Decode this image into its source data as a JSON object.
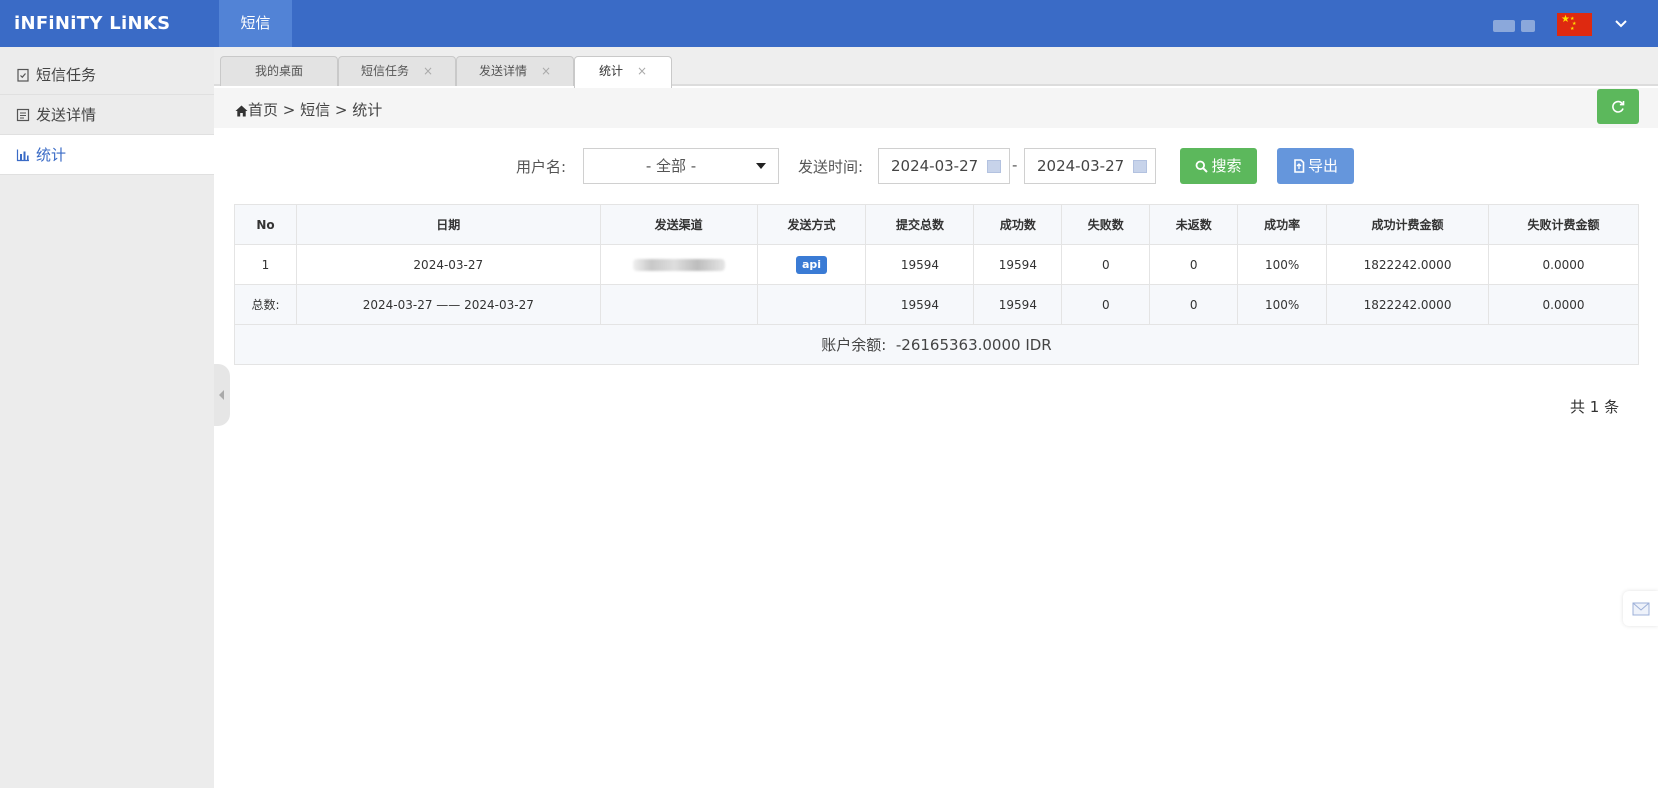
{
  "header": {
    "brand": "iNFiNiTY LiNKS",
    "nav_active": "短信"
  },
  "sidebar": {
    "items": [
      {
        "label": "短信任务",
        "icon": "clipboard-check-icon"
      },
      {
        "label": "发送详情",
        "icon": "document-list-icon"
      },
      {
        "label": "统计",
        "icon": "bar-chart-icon",
        "active": true
      }
    ]
  },
  "tabs": [
    {
      "label": "我的桌面"
    },
    {
      "label": "短信任务",
      "close": "×"
    },
    {
      "label": "发送详情",
      "close": "×"
    },
    {
      "label": "统计",
      "close": "×",
      "active": true
    }
  ],
  "breadcrumb": {
    "home": "首页",
    "sep": " > ",
    "section": "短信",
    "page": "统计"
  },
  "filters": {
    "username_label": "用户名:",
    "username_value": "- 全部 -",
    "time_label": "发送时间:",
    "date_from": "2024-03-27",
    "date_sep": "-",
    "date_to": "2024-03-27",
    "search_label": "搜索",
    "export_label": "导出"
  },
  "table": {
    "headers": [
      "No",
      "日期",
      "发送渠道",
      "发送方式",
      "提交总数",
      "成功数",
      "失败数",
      "未返数",
      "成功率",
      "成功计费金额",
      "失败计费金额"
    ],
    "rows": [
      {
        "no": "1",
        "date": "2024-03-27",
        "method": "api",
        "submitted": "19594",
        "success": "19594",
        "failed": "0",
        "pending": "0",
        "rate": "100%",
        "success_amount": "1822242.0000",
        "fail_amount": "0.0000"
      }
    ],
    "total": {
      "label": "总数:",
      "range": "2024-03-27 —— 2024-03-27",
      "submitted": "19594",
      "success": "19594",
      "failed": "0",
      "pending": "0",
      "rate": "100%",
      "success_amount": "1822242.0000",
      "fail_amount": "0.0000"
    },
    "balance_label": "账户余额:",
    "balance_value": "-26165363.0000 IDR"
  },
  "pagination": {
    "count_text": "共 1 条"
  },
  "colors": {
    "header_bg": "#3a6bc6",
    "success_green": "#5cb85c",
    "export_blue": "#6596dc",
    "flag_red": "#de2910"
  }
}
